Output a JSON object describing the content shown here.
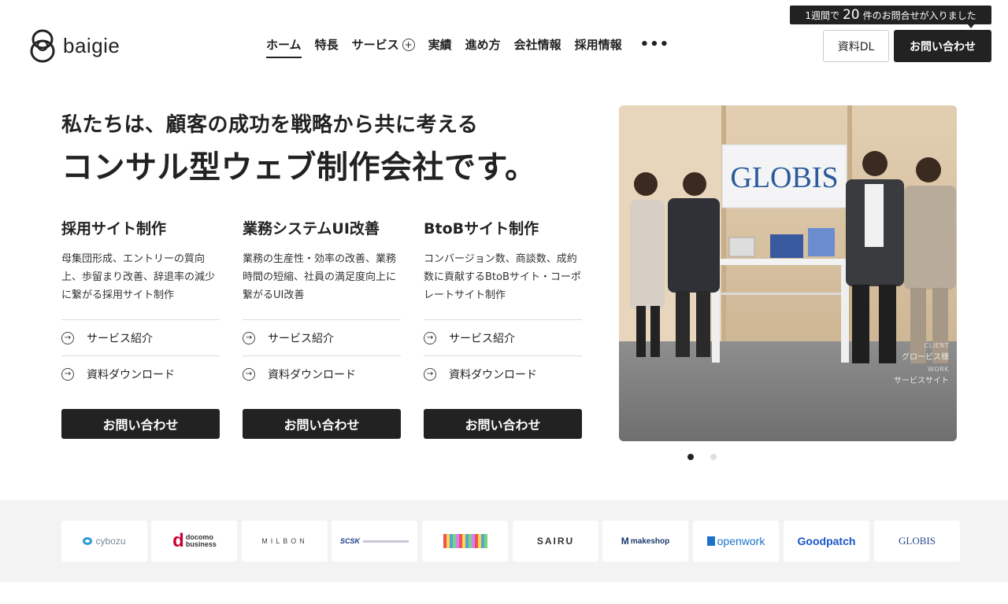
{
  "header": {
    "logo_text": "baigie",
    "nav": [
      {
        "label": "ホーム",
        "active": true
      },
      {
        "label": "特長"
      },
      {
        "label": "サービス",
        "has_plus": true
      },
      {
        "label": "実績"
      },
      {
        "label": "進め方"
      },
      {
        "label": "会社情報"
      },
      {
        "label": "採用情報"
      }
    ],
    "more": "•••",
    "notice": {
      "prefix": "1週間で",
      "count": "20",
      "suffix": "件のお問合せが入りました"
    },
    "download_label": "資料DL",
    "contact_label": "お問い合わせ"
  },
  "hero": {
    "subtitle": "私たちは、顧客の成功を戦略から共に考える",
    "title": "コンサル型ウェブ制作会社です。"
  },
  "services": [
    {
      "title": "採用サイト制作",
      "desc": "母集団形成、エントリーの質向上、歩留まり改善、辞退率の減少に繋がる採用サイト制作",
      "links": [
        "サービス紹介",
        "資料ダウンロード"
      ],
      "cta": "お問い合わせ"
    },
    {
      "title": "業務システムUI改善",
      "desc": "業務の生産性・効率の改善、業務時間の短縮、社員の満足度向上に繋がるUI改善",
      "links": [
        "サービス紹介",
        "資料ダウンロード"
      ],
      "cta": "お問い合わせ"
    },
    {
      "title": "BtoBサイト制作",
      "desc": "コンバージョン数、商談数、成約数に貢献するBtoBサイト・コーポレートサイト制作",
      "links": [
        "サービス紹介",
        "資料ダウンロード"
      ],
      "cta": "お問い合わせ"
    }
  ],
  "photo": {
    "sign_text": "GLOBIS",
    "caption_client_label": "CLIENT",
    "caption_client": "グロービス様",
    "caption_work_label": "WORK",
    "caption_work": "サービスサイト"
  },
  "carousel": {
    "count": 2,
    "active": 0
  },
  "client_logos": [
    {
      "name": "cybozu",
      "text": "cybozu",
      "color": "#7a8a99"
    },
    {
      "name": "docomo-business",
      "text": "docomo business",
      "color": "#cc0033"
    },
    {
      "name": "milbon",
      "text": "MILBON",
      "color": "#444444"
    },
    {
      "name": "scsk",
      "text": "SCSK",
      "color": "#1a3a8c"
    },
    {
      "name": "tokyo-media",
      "text": "",
      "color": "#888888"
    },
    {
      "name": "sairu",
      "text": "SAIRU",
      "color": "#333333"
    },
    {
      "name": "makeshop",
      "text": "makeshop",
      "color": "#1a3a6c"
    },
    {
      "name": "openwork",
      "text": "openwork",
      "color": "#1a73c8"
    },
    {
      "name": "goodpatch",
      "text": "Goodpatch",
      "color": "#1a56c8"
    },
    {
      "name": "globis",
      "text": "GLOBIS",
      "color": "#2a4a8c"
    }
  ]
}
